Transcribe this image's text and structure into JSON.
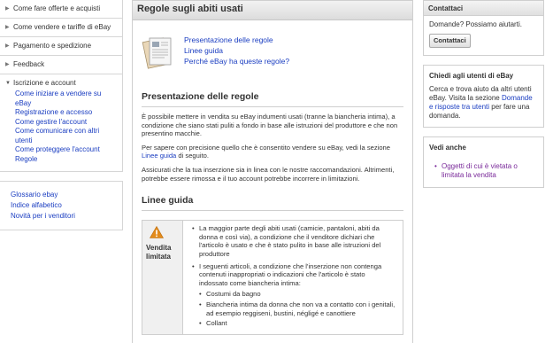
{
  "leftnav": {
    "items": [
      {
        "label": "Come fare offerte e acquisti"
      },
      {
        "label": "Come vendere e tariffe di eBay"
      },
      {
        "label": "Pagamento e spedizione"
      },
      {
        "label": "Feedback"
      },
      {
        "label": "Iscrizione e account"
      }
    ],
    "sublinks": [
      "Come iniziare a vendere su eBay",
      "Registrazione e accesso",
      "Come gestire l'account",
      "Come comunicare con altri utenti",
      "Come proteggere l'account",
      "Regole"
    ],
    "plain_links": [
      "Glossario ebay",
      "Indice alfabetico",
      "Novità per i venditori"
    ]
  },
  "main": {
    "title": "Regole sugli abiti usati",
    "toc": [
      "Presentazione delle regole",
      "Linee guida",
      "Perché eBay ha queste regole?"
    ],
    "section1_title": "Presentazione delle regole",
    "para1": "È possibile mettere in vendita su eBay indumenti usati (tranne la biancheria intima), a condizione che siano stati puliti a fondo in base alle istruzioni del produttore e che non presentino macchie.",
    "para2_pre": "Per sapere con precisione quello che è consentito vendere su eBay, vedi la sezione ",
    "para2_link": "Linee guida",
    "para2_post": " di seguito.",
    "para3": "Assicurati che la tua inserzione sia in linea con le nostre raccomandazioni. Altrimenti, potrebbe essere rimossa e il tuo account potrebbe incorrere in limitazioni.",
    "section2_title": "Linee guida",
    "guide_label": "Vendita limitata",
    "guide_items": [
      "La maggior parte degli abiti usati (camicie, pantaloni, abiti da donna e così via), a condizione che il venditore dichiari che l'articolo è usato e che è stato pulito in base alle istruzioni del produttore",
      "I seguenti articoli, a condizione che l'inserzione non contenga contenuti inappropriati o indicazioni che l'articolo è stato indossato come biancheria intima:"
    ],
    "guide_subitems": [
      "Costumi da bagno",
      "Biancheria intima da donna che non va a contatto con i genitali, ad esempio reggiseni, bustini, négligé e canottiere",
      "Collant"
    ]
  },
  "right": {
    "contact_title": "Contattaci",
    "contact_text": "Domande? Possiamo aiutarti.",
    "contact_button": "Contattaci",
    "ask_title": "Chiedi agli utenti di eBay",
    "ask_text_pre": "Cerca e trova aiuto da altri utenti eBay. Visita la sezione ",
    "ask_link": "Domande e risposte tra utenti",
    "ask_text_post": " per fare una domanda.",
    "see_title": "Vedi anche",
    "see_link": "Oggetti di cui è vietata o limitata la vendita"
  }
}
